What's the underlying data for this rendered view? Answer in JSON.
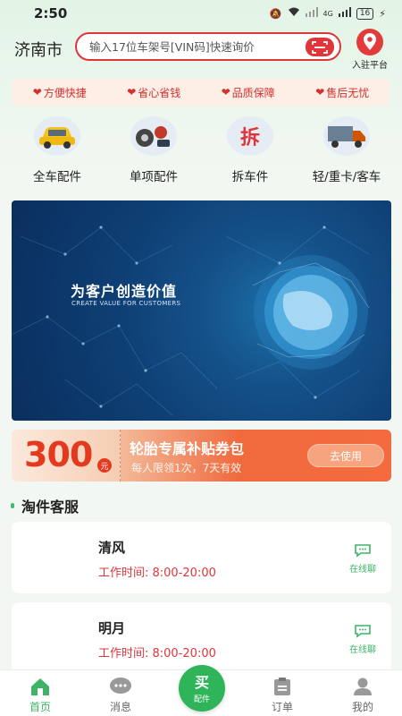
{
  "status_bar": {
    "time": "2:50",
    "network": "4G",
    "battery": "16"
  },
  "header": {
    "city": "济南市",
    "search_placeholder": "输入17位车架号[VIN码]快速询价",
    "entry_label": "入驻平台"
  },
  "features": [
    {
      "label": "方便快捷",
      "icon": "heart-icon"
    },
    {
      "label": "省心省钱",
      "icon": "heart-icon"
    },
    {
      "label": "品质保障",
      "icon": "heart-icon"
    },
    {
      "label": "售后无忧",
      "icon": "heart-icon"
    }
  ],
  "categories": [
    {
      "label": "全车配件",
      "icon": "car-icon"
    },
    {
      "label": "单项配件",
      "icon": "parts-icon"
    },
    {
      "label": "拆车件",
      "icon": "dismantle-icon",
      "icon_text": "拆"
    },
    {
      "label": "轻/重卡/客车",
      "icon": "truck-icon"
    }
  ],
  "banner": {
    "title": "为客户创造价值",
    "subtitle": "CREATE VALUE FOR CUSTOMERS"
  },
  "coupon": {
    "amount": "300",
    "unit": "元",
    "title": "轮胎专属补贴券包",
    "desc": "每人限领1次，7天有效",
    "button": "去使用"
  },
  "section": {
    "title": "淘件客服"
  },
  "services": [
    {
      "name": "清风",
      "hours": "工作时间: 8:00-20:00",
      "chat_label": "在线聊"
    },
    {
      "name": "明月",
      "hours": "工作时间: 8:00-20:00",
      "chat_label": "在线聊"
    }
  ],
  "tabs": {
    "home": "首页",
    "messages": "消息",
    "center_main": "买",
    "center_sub": "配件",
    "orders": "订单",
    "mine": "我的"
  },
  "colors": {
    "accent_red": "#e0353a",
    "accent_green": "#3fb467"
  }
}
